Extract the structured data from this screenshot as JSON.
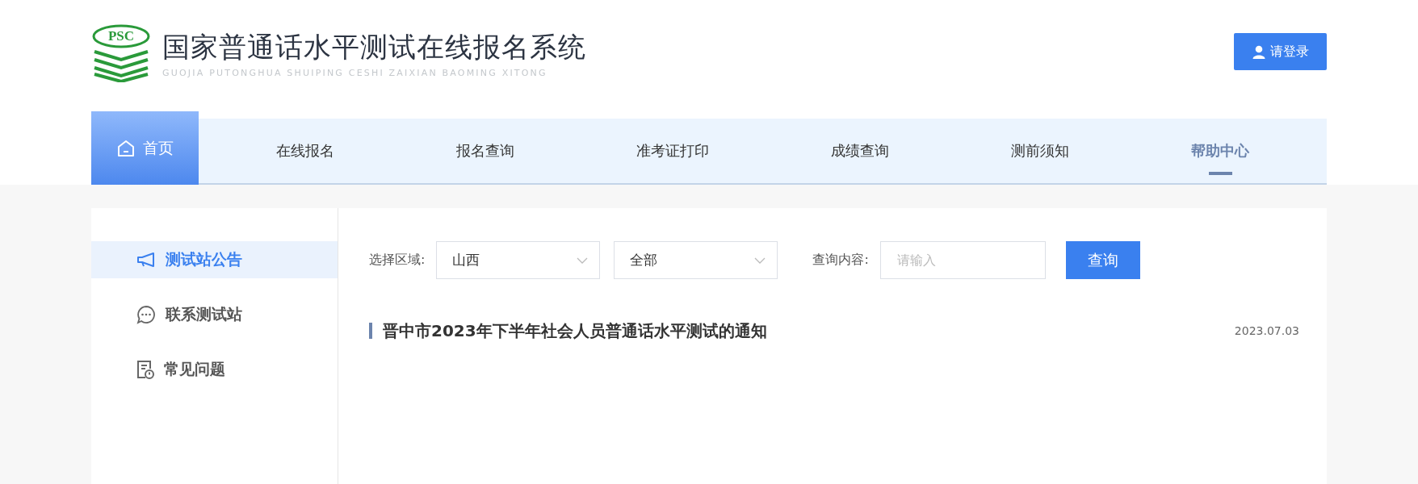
{
  "header": {
    "logo_text": "PSC",
    "title": "国家普通话水平测试在线报名系统",
    "subtitle": "GUOJIA PUTONGHUA SHUIPING CESHI ZAIXIAN BAOMING XITONG",
    "login_button": "请登录"
  },
  "nav": {
    "home": {
      "label": "首页"
    },
    "items": [
      {
        "label": "在线报名",
        "selected": false
      },
      {
        "label": "报名查询",
        "selected": false
      },
      {
        "label": "准考证打印",
        "selected": false
      },
      {
        "label": "成绩查询",
        "selected": false
      },
      {
        "label": "测前须知",
        "selected": false
      },
      {
        "label": "帮助中心",
        "selected": true
      }
    ]
  },
  "sidebar": {
    "items": [
      {
        "label": "测试站公告",
        "kind": "megaphone",
        "selected": true
      },
      {
        "label": "联系测试站",
        "kind": "chat",
        "selected": false
      },
      {
        "label": "常见问题",
        "kind": "document",
        "selected": false
      }
    ]
  },
  "filter": {
    "region_label": "选择区域:",
    "province": "山西",
    "city": "全部",
    "query_label": "查询内容:",
    "query_placeholder": "请输入",
    "search_button": "查询"
  },
  "notices": [
    {
      "title": "晋中市2023年下半年社会人员普通话水平测试的通知",
      "date": "2023.07.03"
    }
  ]
}
